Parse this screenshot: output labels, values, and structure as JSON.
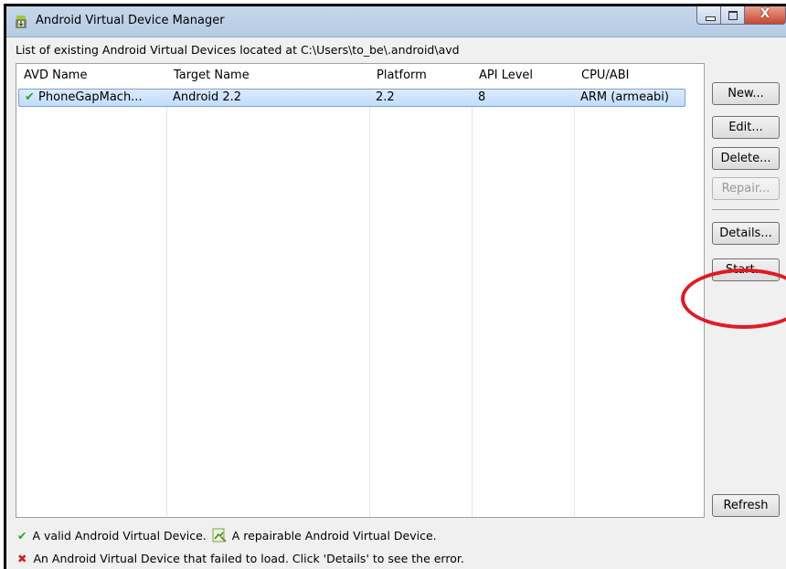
{
  "window": {
    "title": "Android Virtual Device Manager",
    "close_glyph": "X"
  },
  "description": "List of existing Android Virtual Devices located at C:\\Users\\to_be\\.android\\avd",
  "table": {
    "columns": [
      "AVD Name",
      "Target Name",
      "Platform",
      "API Level",
      "CPU/ABI"
    ],
    "rows": [
      {
        "status_icon": "check-icon",
        "avd_name": "PhoneGapMach...",
        "target_name": "Android 2.2",
        "platform": "2.2",
        "api_level": "8",
        "cpu_abi": "ARM (armeabi)"
      }
    ]
  },
  "buttons": {
    "new": "New...",
    "edit": "Edit...",
    "delete": "Delete...",
    "repair": "Repair...",
    "details": "Details...",
    "start": "Start...",
    "refresh": "Refresh"
  },
  "legend": {
    "valid": "A valid Android Virtual Device.",
    "repairable": "A repairable Android Virtual Device.",
    "failed": "An Android Virtual Device that failed to load. Click 'Details' to see the error."
  },
  "glyphs": {
    "check": "✔",
    "cross": "✖"
  },
  "colors": {
    "valid_green": "#2aa52a",
    "error_red": "#d0231a",
    "highlight_ring": "#e01b22",
    "selected_row": "#c1dcfc"
  }
}
